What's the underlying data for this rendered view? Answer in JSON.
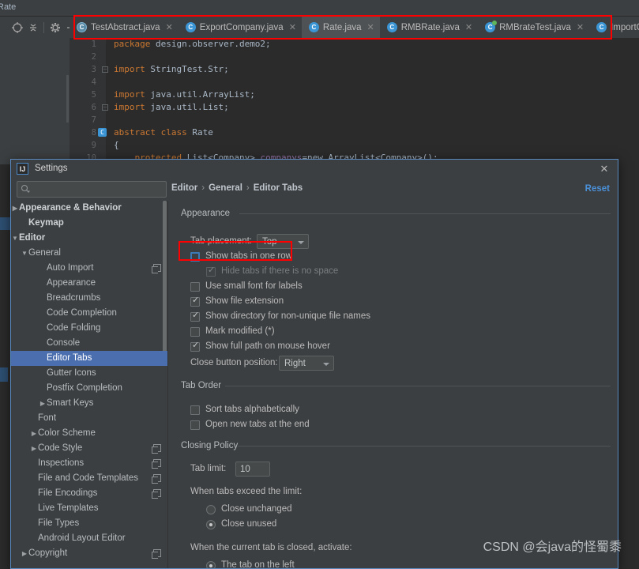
{
  "ide": {
    "top_label": "Rate",
    "toolbar_icons": [
      "locate-icon",
      "collapse-all-icon",
      "settings-gear-icon",
      "hide-icon"
    ],
    "tabs": [
      {
        "label": "TestAbstract.java",
        "icon": "abstract-class-icon",
        "icon_kind": "abs",
        "active": false,
        "closable": true
      },
      {
        "label": "ExportCompany.java",
        "icon": "java-class-icon",
        "icon_kind": "cls",
        "active": false,
        "closable": true
      },
      {
        "label": "Rate.java",
        "icon": "java-class-icon",
        "icon_kind": "cls",
        "active": true,
        "closable": true
      },
      {
        "label": "RMBRate.java",
        "icon": "java-class-icon",
        "icon_kind": "cls",
        "active": false,
        "closable": true
      },
      {
        "label": "RMBrateTest.java",
        "icon": "runnable-class-icon",
        "icon_kind": "run",
        "active": false,
        "closable": true
      },
      {
        "label": "ImportCompany.java",
        "icon": "java-class-icon",
        "icon_kind": "cls",
        "active": false,
        "closable": true
      },
      {
        "label": "",
        "icon": "java-interface-icon",
        "icon_kind": "iface",
        "active": false,
        "closable": false
      }
    ],
    "code_lines": [
      {
        "n": "1",
        "text": "package design.observer.demo2;",
        "cls": "kw-pkg"
      },
      {
        "n": "2",
        "text": "",
        "cls": ""
      },
      {
        "n": "3",
        "text": "import StringTest.Str;",
        "cls": "",
        "fold": true
      },
      {
        "n": "4",
        "text": "",
        "cls": ""
      },
      {
        "n": "5",
        "text": "import java.util.ArrayList;",
        "cls": ""
      },
      {
        "n": "6",
        "text": "import java.util.List;",
        "cls": "",
        "fold": true
      },
      {
        "n": "7",
        "text": "",
        "cls": ""
      },
      {
        "n": "8",
        "text": "abstract class Rate",
        "cls": "",
        "gmark": true
      },
      {
        "n": "9",
        "text": "{",
        "cls": ""
      },
      {
        "n": "10",
        "text": "    protected List<Company> companys=new ArrayList<Company>();",
        "cls": ""
      }
    ]
  },
  "dialog": {
    "title": "Settings",
    "logo_text": "IJ",
    "close_icon": "close-icon",
    "search_placeholder": "",
    "search_value": "",
    "search_icon": "search-icon",
    "breadcrumb": [
      "Editor",
      "General",
      "Editor Tabs"
    ],
    "breadcrumb_separator": "›",
    "reset_label": "Reset",
    "tree": [
      {
        "label": "Appearance & Behavior",
        "indent": 10,
        "arrow": "▶",
        "bold": true,
        "selected": false,
        "copy": false
      },
      {
        "label": "Keymap",
        "indent": 22,
        "arrow": "",
        "bold": true,
        "selected": false,
        "copy": false
      },
      {
        "label": "Editor",
        "indent": 10,
        "arrow": "▼",
        "bold": true,
        "selected": false,
        "copy": false
      },
      {
        "label": "General",
        "indent": 22,
        "arrow": "▼",
        "bold": false,
        "selected": false,
        "copy": false
      },
      {
        "label": "Auto Import",
        "indent": 45,
        "arrow": "",
        "bold": false,
        "selected": false,
        "copy": true
      },
      {
        "label": "Appearance",
        "indent": 45,
        "arrow": "",
        "bold": false,
        "selected": false,
        "copy": false
      },
      {
        "label": "Breadcrumbs",
        "indent": 45,
        "arrow": "",
        "bold": false,
        "selected": false,
        "copy": false
      },
      {
        "label": "Code Completion",
        "indent": 45,
        "arrow": "",
        "bold": false,
        "selected": false,
        "copy": false
      },
      {
        "label": "Code Folding",
        "indent": 45,
        "arrow": "",
        "bold": false,
        "selected": false,
        "copy": false
      },
      {
        "label": "Console",
        "indent": 45,
        "arrow": "",
        "bold": false,
        "selected": false,
        "copy": false
      },
      {
        "label": "Editor Tabs",
        "indent": 45,
        "arrow": "",
        "bold": false,
        "selected": true,
        "copy": false
      },
      {
        "label": "Gutter Icons",
        "indent": 45,
        "arrow": "",
        "bold": false,
        "selected": false,
        "copy": false
      },
      {
        "label": "Postfix Completion",
        "indent": 45,
        "arrow": "",
        "bold": false,
        "selected": false,
        "copy": false
      },
      {
        "label": "Smart Keys",
        "indent": 45,
        "arrow": "▶",
        "bold": false,
        "selected": false,
        "copy": false
      },
      {
        "label": "Font",
        "indent": 34,
        "arrow": "",
        "bold": false,
        "selected": false,
        "copy": false
      },
      {
        "label": "Color Scheme",
        "indent": 34,
        "arrow": "▶",
        "bold": false,
        "selected": false,
        "copy": false
      },
      {
        "label": "Code Style",
        "indent": 34,
        "arrow": "▶",
        "bold": false,
        "selected": false,
        "copy": true
      },
      {
        "label": "Inspections",
        "indent": 34,
        "arrow": "",
        "bold": false,
        "selected": false,
        "copy": true
      },
      {
        "label": "File and Code Templates",
        "indent": 34,
        "arrow": "",
        "bold": false,
        "selected": false,
        "copy": true
      },
      {
        "label": "File Encodings",
        "indent": 34,
        "arrow": "",
        "bold": false,
        "selected": false,
        "copy": true
      },
      {
        "label": "Live Templates",
        "indent": 34,
        "arrow": "",
        "bold": false,
        "selected": false,
        "copy": false
      },
      {
        "label": "File Types",
        "indent": 34,
        "arrow": "",
        "bold": false,
        "selected": false,
        "copy": false
      },
      {
        "label": "Android Layout Editor",
        "indent": 34,
        "arrow": "",
        "bold": false,
        "selected": false,
        "copy": false
      },
      {
        "label": "Copyright",
        "indent": 22,
        "arrow": "▶",
        "bold": false,
        "selected": false,
        "copy": true
      }
    ],
    "pane": {
      "group_appearance": "Appearance",
      "tab_placement_label": "Tab placement:",
      "tab_placement_value": "Top",
      "checkboxes": [
        {
          "label": "Show tabs in one row",
          "checked": false,
          "dim": false,
          "focused": true
        },
        {
          "label": "Hide tabs if there is no space",
          "checked": true,
          "dim": true,
          "focused": false
        },
        {
          "label": "Use small font for labels",
          "checked": false,
          "dim": false,
          "focused": false
        },
        {
          "label": "Show file extension",
          "checked": true,
          "dim": false,
          "focused": false
        },
        {
          "label": "Show directory for non-unique file names",
          "checked": true,
          "dim": false,
          "focused": false
        },
        {
          "label": "Mark modified (*)",
          "checked": false,
          "dim": false,
          "focused": false
        },
        {
          "label": "Show full path on mouse hover",
          "checked": true,
          "dim": false,
          "focused": false
        }
      ],
      "close_button_label": "Close button position:",
      "close_button_value": "Right",
      "group_tab_order": "Tab Order",
      "tab_order_checkboxes": [
        {
          "label": "Sort tabs alphabetically",
          "checked": false
        },
        {
          "label": "Open new tabs at the end",
          "checked": false
        }
      ],
      "group_closing_policy": "Closing Policy",
      "tab_limit_label": "Tab limit:",
      "tab_limit_value": "10",
      "exceed_label": "When tabs exceed the limit:",
      "exceed_options": [
        {
          "label": "Close unchanged",
          "selected": false
        },
        {
          "label": "Close unused",
          "selected": true
        }
      ],
      "closed_label": "When the current tab is closed, activate:",
      "closed_options": [
        {
          "label": "The tab on the left",
          "selected": true
        }
      ]
    }
  },
  "watermark": "CSDN @会java的怪蜀黍",
  "colors": {
    "accent_blue": "#4a90d9",
    "selection_blue": "#4b6eaf",
    "highlight_red": "#ff0000",
    "panel_bg": "#3c3f41",
    "editor_bg": "#2b2b2b"
  }
}
